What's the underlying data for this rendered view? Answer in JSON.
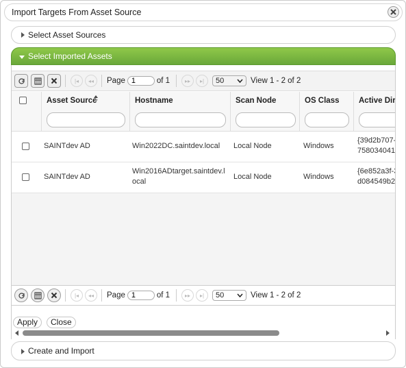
{
  "dialog": {
    "title": "Import Targets From Asset Source"
  },
  "sections": {
    "asset_sources": "Select Asset Sources",
    "imported_assets": "Select Imported Assets",
    "create_import": "Create and Import"
  },
  "pager": {
    "page_label": "Page",
    "page_value": "1",
    "of_label": "of 1",
    "rows_per_page": "50",
    "view_text": "View 1 - 2 of 2"
  },
  "table": {
    "columns": [
      "Asset Source",
      "Hostname",
      "Scan Node",
      "OS Class",
      "Active Dire"
    ],
    "rows": [
      {
        "asset_source": "SAINTdev AD",
        "hostname": [
          "Win2022DC.saintdev.local"
        ],
        "scan_node": "Local Node",
        "os_class": "Windows",
        "active_dir": [
          "{39d2b707-",
          "758034041"
        ]
      },
      {
        "asset_source": "SAINTdev AD",
        "hostname": [
          "Win2016ADtarget.saintdev.l",
          "ocal"
        ],
        "scan_node": "Local Node",
        "os_class": "Windows",
        "active_dir": [
          "{6e852a3f-3",
          "d084549b2"
        ]
      }
    ]
  },
  "buttons": {
    "apply": "Apply",
    "close": "Close"
  },
  "icons": {
    "close": "close-icon",
    "refresh": "refresh-icon",
    "columns": "columns-icon",
    "clear": "clear-icon",
    "first": "first-page-icon",
    "prev": "prev-page-icon",
    "next": "next-page-icon",
    "last": "last-page-icon"
  },
  "colors": {
    "accent_green": "#7ab843"
  }
}
